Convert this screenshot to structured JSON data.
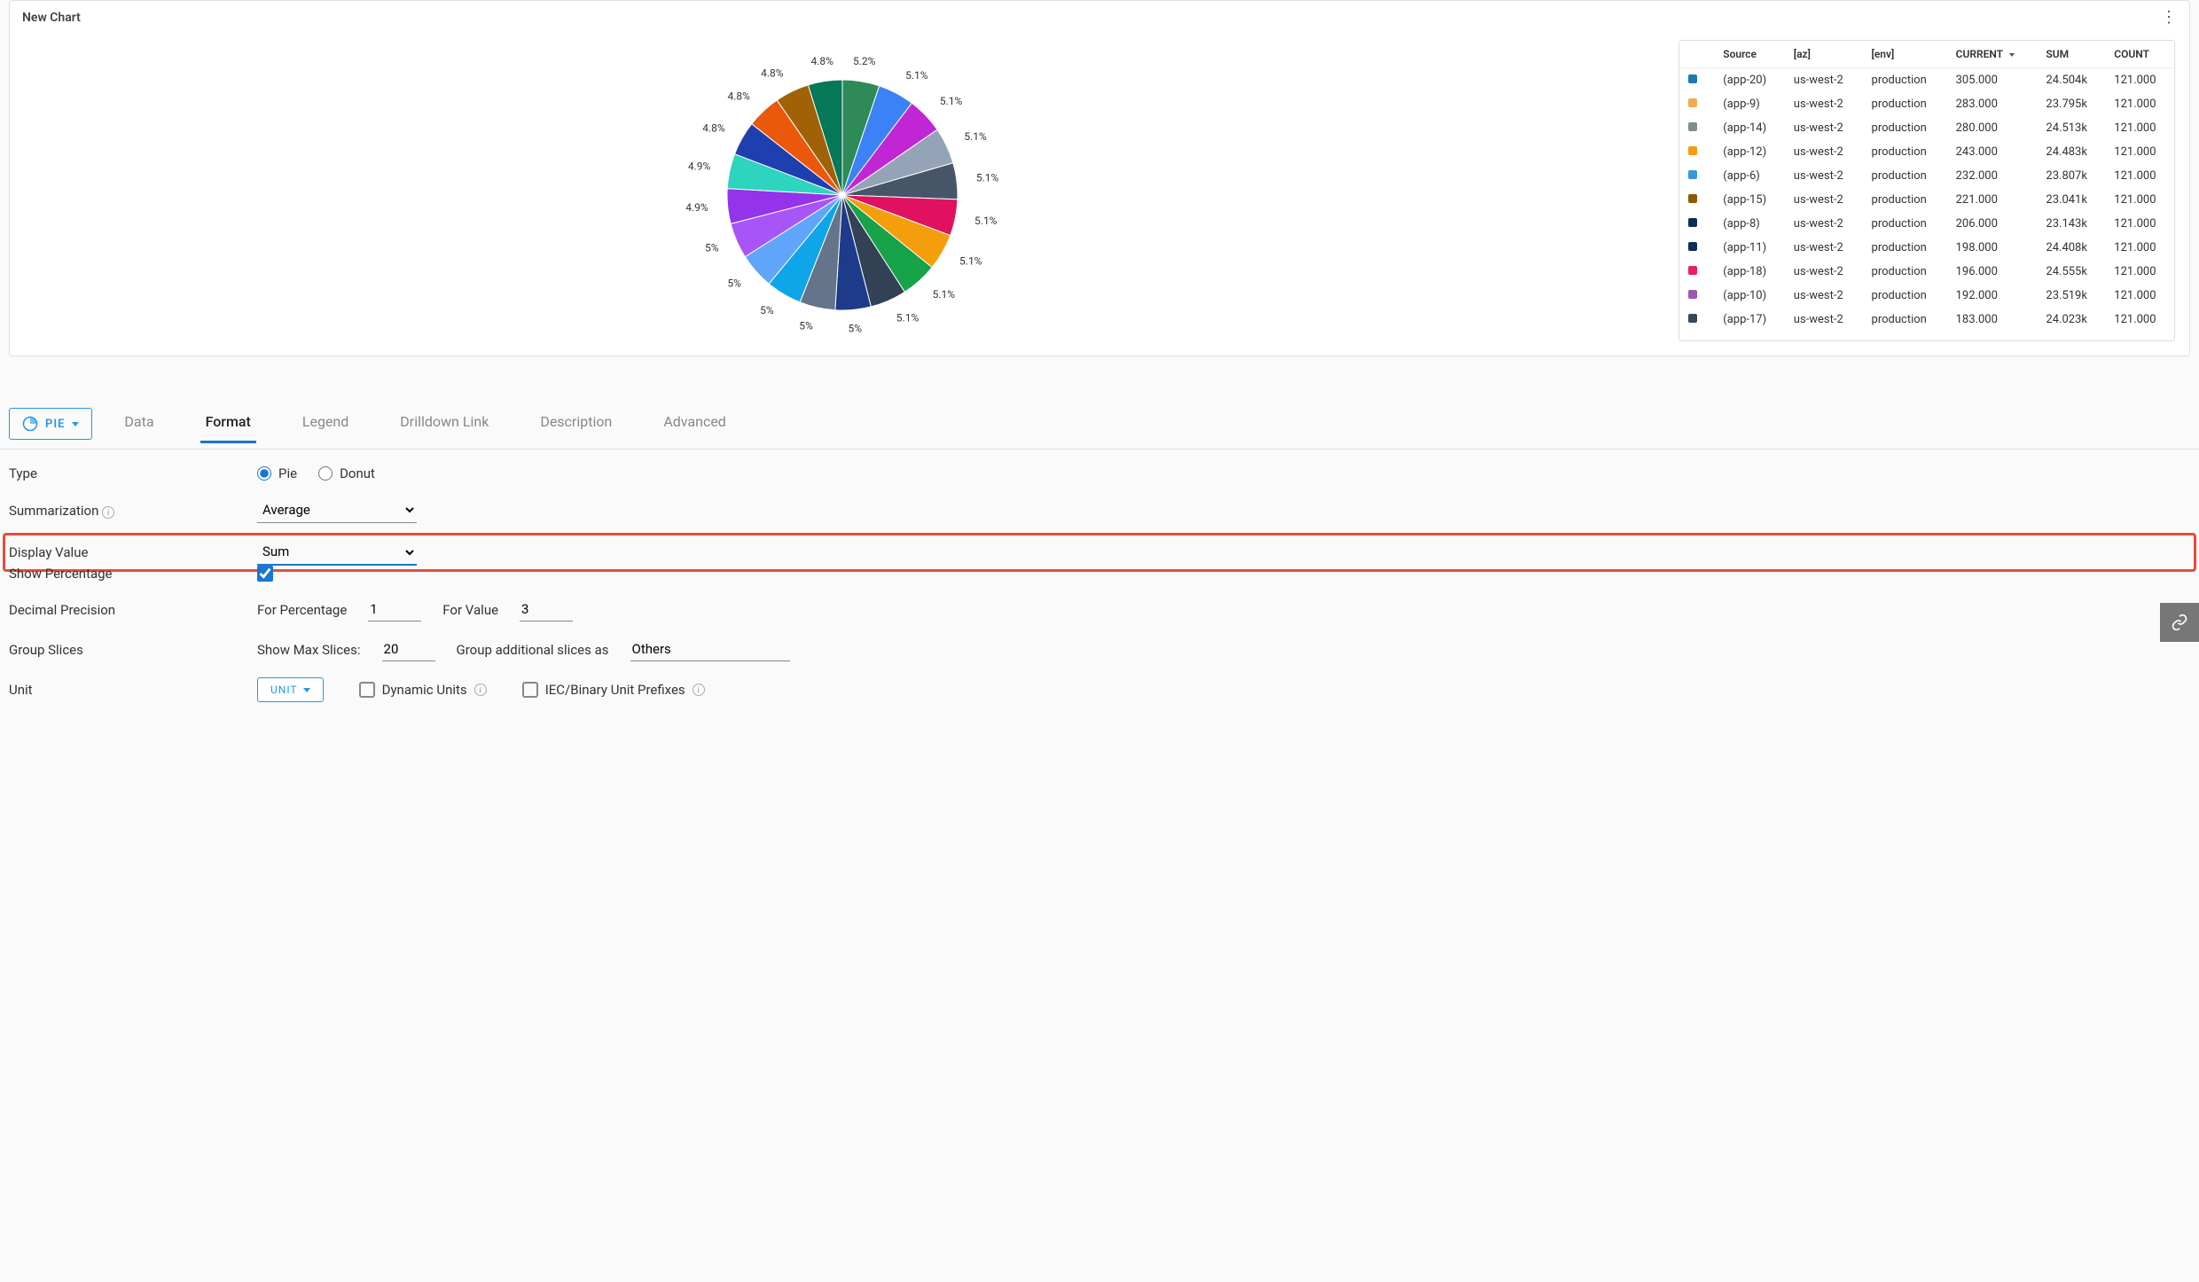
{
  "chart": {
    "title": "New Chart"
  },
  "pie_labels": [
    "5.2%",
    "5.1%",
    "5.1%",
    "5.1%",
    "5.1%",
    "5.1%",
    "5.1%",
    "5.1%",
    "5.1%",
    "5%",
    "5%",
    "5%",
    "5%",
    "5%",
    "4.9%",
    "4.9%",
    "4.8%",
    "4.8%",
    "4.8%",
    "4.8%"
  ],
  "legend": {
    "headers": {
      "source": "Source",
      "az": "[az]",
      "env": "[env]",
      "current": "CURRENT",
      "sum": "SUM",
      "count": "COUNT"
    },
    "rows": [
      {
        "color": "#1f77b4",
        "source": "(app-20)",
        "az": "us-west-2",
        "env": "production",
        "current": "305.000",
        "sum": "24.504k",
        "count": "121.000"
      },
      {
        "color": "#f0ad4e",
        "source": "(app-9)",
        "az": "us-west-2",
        "env": "production",
        "current": "283.000",
        "sum": "23.795k",
        "count": "121.000"
      },
      {
        "color": "#7f8c8d",
        "source": "(app-14)",
        "az": "us-west-2",
        "env": "production",
        "current": "280.000",
        "sum": "24.513k",
        "count": "121.000"
      },
      {
        "color": "#f39c12",
        "source": "(app-12)",
        "az": "us-west-2",
        "env": "production",
        "current": "243.000",
        "sum": "24.483k",
        "count": "121.000"
      },
      {
        "color": "#3498db",
        "source": "(app-6)",
        "az": "us-west-2",
        "env": "production",
        "current": "232.000",
        "sum": "23.807k",
        "count": "121.000"
      },
      {
        "color": "#8b5a00",
        "source": "(app-15)",
        "az": "us-west-2",
        "env": "production",
        "current": "221.000",
        "sum": "23.041k",
        "count": "121.000"
      },
      {
        "color": "#0b2e59",
        "source": "(app-8)",
        "az": "us-west-2",
        "env": "production",
        "current": "206.000",
        "sum": "23.143k",
        "count": "121.000"
      },
      {
        "color": "#0b2e59",
        "source": "(app-11)",
        "az": "us-west-2",
        "env": "production",
        "current": "198.000",
        "sum": "24.408k",
        "count": "121.000"
      },
      {
        "color": "#e91e63",
        "source": "(app-18)",
        "az": "us-west-2",
        "env": "production",
        "current": "196.000",
        "sum": "24.555k",
        "count": "121.000"
      },
      {
        "color": "#9b59b6",
        "source": "(app-10)",
        "az": "us-west-2",
        "env": "production",
        "current": "192.000",
        "sum": "23.519k",
        "count": "121.000"
      },
      {
        "color": "#34495e",
        "source": "(app-17)",
        "az": "us-west-2",
        "env": "production",
        "current": "183.000",
        "sum": "24.023k",
        "count": "121.000"
      }
    ]
  },
  "chart_type_button": "PIE",
  "tabs": [
    "Data",
    "Format",
    "Legend",
    "Drilldown Link",
    "Description",
    "Advanced"
  ],
  "active_tab": "Format",
  "form": {
    "type_label": "Type",
    "type_pie": "Pie",
    "type_donut": "Donut",
    "summarization_label": "Summarization",
    "summarization_value": "Average",
    "display_value_label": "Display Value",
    "display_value_value": "Sum",
    "show_percentage_label": "Show Percentage",
    "decimal_precision_label": "Decimal Precision",
    "for_percentage_label": "For Percentage",
    "for_percentage_value": "1",
    "for_value_label": "For Value",
    "for_value_value": "3",
    "group_slices_label": "Group Slices",
    "max_slices_label": "Show Max Slices:",
    "max_slices_value": "20",
    "group_as_label": "Group additional slices as",
    "group_as_value": "Others",
    "unit_label": "Unit",
    "unit_button": "UNIT",
    "dynamic_units_label": "Dynamic Units",
    "iec_label": "IEC/Binary Unit Prefixes"
  },
  "chart_data": {
    "type": "pie",
    "title": "New Chart",
    "display_value": "Sum",
    "slices_percent": [
      5.2,
      5.1,
      5.1,
      5.1,
      5.1,
      5.1,
      5.1,
      5.1,
      5.1,
      5.0,
      5.0,
      5.0,
      5.0,
      5.0,
      4.9,
      4.9,
      4.8,
      4.8,
      4.8,
      4.8
    ],
    "legend_sample": [
      {
        "source": "(app-20)",
        "az": "us-west-2",
        "env": "production",
        "current": 305.0,
        "sum": 24504,
        "count": 121
      },
      {
        "source": "(app-9)",
        "az": "us-west-2",
        "env": "production",
        "current": 283.0,
        "sum": 23795,
        "count": 121
      },
      {
        "source": "(app-14)",
        "az": "us-west-2",
        "env": "production",
        "current": 280.0,
        "sum": 24513,
        "count": 121
      },
      {
        "source": "(app-12)",
        "az": "us-west-2",
        "env": "production",
        "current": 243.0,
        "sum": 24483,
        "count": 121
      },
      {
        "source": "(app-6)",
        "az": "us-west-2",
        "env": "production",
        "current": 232.0,
        "sum": 23807,
        "count": 121
      },
      {
        "source": "(app-15)",
        "az": "us-west-2",
        "env": "production",
        "current": 221.0,
        "sum": 23041,
        "count": 121
      },
      {
        "source": "(app-8)",
        "az": "us-west-2",
        "env": "production",
        "current": 206.0,
        "sum": 23143,
        "count": 121
      },
      {
        "source": "(app-11)",
        "az": "us-west-2",
        "env": "production",
        "current": 198.0,
        "sum": 24408,
        "count": 121
      },
      {
        "source": "(app-18)",
        "az": "us-west-2",
        "env": "production",
        "current": 196.0,
        "sum": 24555,
        "count": 121
      },
      {
        "source": "(app-10)",
        "az": "us-west-2",
        "env": "production",
        "current": 192.0,
        "sum": 23519,
        "count": 121
      },
      {
        "source": "(app-17)",
        "az": "us-west-2",
        "env": "production",
        "current": 183.0,
        "sum": 24023,
        "count": 121
      }
    ]
  }
}
